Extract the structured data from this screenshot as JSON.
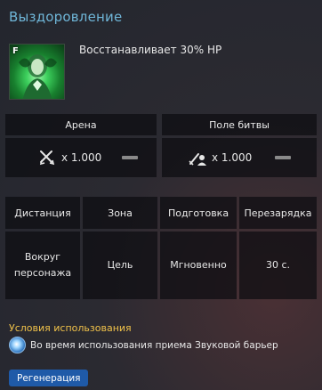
{
  "skill": {
    "title": "Выздоровление",
    "grade": "F",
    "description": "Восстанавливает 30% HP",
    "icon": "healer-portrait-icon"
  },
  "modes": [
    {
      "header": "Арена",
      "icon": "crossed-swords-icon",
      "value": "x 1.000",
      "dash_icon": "dash-icon"
    },
    {
      "header": "Поле битвы",
      "icon": "battlefield-sword-icon",
      "value": "x 1.000",
      "dash_icon": "dash-icon"
    }
  ],
  "stats": {
    "headers": [
      "Дистанция",
      "Зона",
      "Подготовка",
      "Перезарядка"
    ],
    "values": [
      "Вокруг персонажа",
      "Цель",
      "Мгновенно",
      "30 с."
    ]
  },
  "conditions": {
    "title": "Условия использования",
    "icon": "sound-barrier-icon",
    "text": "Во время использования приема Звуковой барьер"
  },
  "tag": {
    "label": "Регенерация"
  },
  "colors": {
    "title": "#6fb6d8",
    "conditions_title": "#f0c24a",
    "tag_bg": "#1f5aa8"
  }
}
